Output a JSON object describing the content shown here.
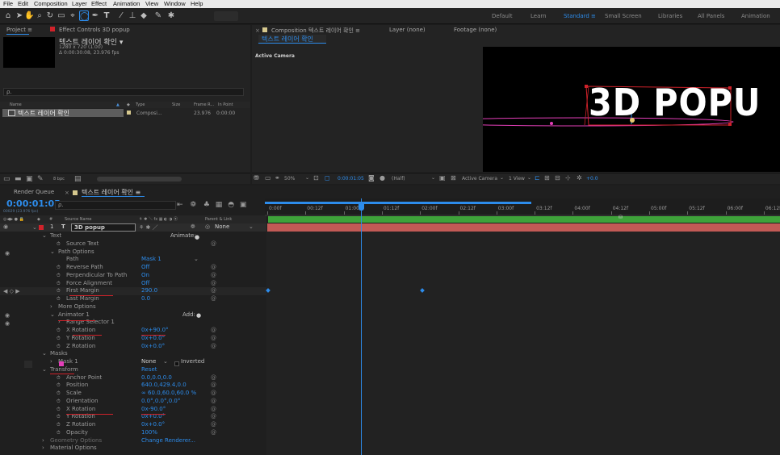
{
  "menu": [
    "File",
    "Edit",
    "Composition",
    "Layer",
    "Effect",
    "Animation",
    "View",
    "Window",
    "Help"
  ],
  "workspaces": [
    "Default",
    "Learn",
    "Standard",
    "Small Screen",
    "Libraries",
    "All Panels",
    "Animation"
  ],
  "project_panel": {
    "tab_project": "Project",
    "tab_effects": "Effect Controls 3D popup",
    "comp_name": "텍스트 레이어 확인 ▾",
    "comp_size": "1280 x 720 (1.00)",
    "comp_duration": "Δ 0:00:30:08, 23.976 fps",
    "search_placeholder": "ρ.",
    "col_name": "Name",
    "col_type": "Type",
    "col_size": "Size",
    "col_framerate": "Frame R...",
    "col_inpoint": "In Point",
    "item_name": "텍스트 레이어 확인",
    "item_type": "Composi...",
    "item_fps": "23.976",
    "item_in": "0:00:00",
    "bpc": "8 bpc"
  },
  "viewer": {
    "tab_comp": "Composition 텍스트 레이어 확인",
    "tab_layer": "Layer (none)",
    "tab_footage": "Footage (none)",
    "breadcrumb": "텍스트 레이어 확인",
    "active_camera": "Active Camera",
    "canvas_text": "3D POPU",
    "zoom": "50%",
    "timecode": "0:00:01:05",
    "resolution": "(Half)",
    "camera": "Active Camera",
    "views": "1 View",
    "exposure": "+0.0"
  },
  "timeline": {
    "tab_render": "Render Queue",
    "tab_comp": "텍스트 레이어 확인",
    "timecode": "0:00:01:05",
    "timecode_sub": "00029 (23.976 fps)",
    "search_placeholder": "ρ.",
    "col_source": "Source Name",
    "col_parent": "Parent & Link",
    "layer_num": "1",
    "layer_name": "3D popup",
    "parent_value": "None",
    "ruler": [
      "0:00f",
      "00:12f",
      "01:00f",
      "01:12f",
      "02:00f",
      "02:12f",
      "03:00f",
      "03:12f",
      "04:00f",
      "04:12f",
      "05:00f",
      "05:12f",
      "06:00f",
      "06:12f"
    ],
    "props": [
      {
        "label": "Text",
        "indent": 1,
        "arrow": "v",
        "sw": false,
        "value": "",
        "right": "Animate:"
      },
      {
        "label": "Source Text",
        "indent": 3,
        "arrow": "",
        "sw": true,
        "value": "",
        "right": ""
      },
      {
        "label": "Path Options",
        "indent": 2,
        "arrow": "v",
        "sw": false,
        "value": "",
        "right": ""
      },
      {
        "label": "Path",
        "indent": 3,
        "arrow": "",
        "sw": false,
        "value": "Mask 1",
        "right": ""
      },
      {
        "label": "Reverse Path",
        "indent": 3,
        "arrow": "",
        "sw": true,
        "value": "Off",
        "right": ""
      },
      {
        "label": "Perpendicular To Path",
        "indent": 3,
        "arrow": "",
        "sw": true,
        "value": "On",
        "right": ""
      },
      {
        "label": "Force Alignment",
        "indent": 3,
        "arrow": "",
        "sw": true,
        "value": "Off",
        "right": ""
      },
      {
        "label": "First Margin",
        "indent": 3,
        "arrow": "",
        "sw": true,
        "value": "290.0",
        "right": ""
      },
      {
        "label": "Last Margin",
        "indent": 3,
        "arrow": "",
        "sw": true,
        "value": "0.0",
        "right": ""
      },
      {
        "label": "More Options",
        "indent": 2,
        "arrow": ">",
        "sw": false,
        "value": "",
        "right": ""
      },
      {
        "label": "Animator 1",
        "indent": 2,
        "arrow": "v",
        "sw": false,
        "value": "",
        "right": "Add:"
      },
      {
        "label": "Range Selector 1",
        "indent": 3,
        "arrow": ">",
        "sw": false,
        "value": "",
        "right": ""
      },
      {
        "label": "X Rotation",
        "indent": 3,
        "arrow": "",
        "sw": true,
        "value": "0x+90.0°",
        "right": ""
      },
      {
        "label": "Y Rotation",
        "indent": 3,
        "arrow": "",
        "sw": true,
        "value": "0x+0.0°",
        "right": ""
      },
      {
        "label": "Z Rotation",
        "indent": 3,
        "arrow": "",
        "sw": true,
        "value": "0x+0.0°",
        "right": ""
      },
      {
        "label": "Masks",
        "indent": 1,
        "arrow": "v",
        "sw": false,
        "value": "",
        "right": ""
      },
      {
        "label": "Mask 1",
        "indent": 2,
        "arrow": ">",
        "sw": false,
        "value": "None",
        "right": "Inverted"
      },
      {
        "label": "Transform",
        "indent": 1,
        "arrow": "v",
        "sw": false,
        "value": "Reset",
        "right": ""
      },
      {
        "label": "Anchor Point",
        "indent": 3,
        "arrow": "",
        "sw": true,
        "value": "0.0,0.0,0.0",
        "right": ""
      },
      {
        "label": "Position",
        "indent": 3,
        "arrow": "",
        "sw": true,
        "value": "640.0,429.4,0.0",
        "right": ""
      },
      {
        "label": "Scale",
        "indent": 3,
        "arrow": "",
        "sw": true,
        "value": "∞ 60.0,60.0,60.0 %",
        "right": ""
      },
      {
        "label": "Orientation",
        "indent": 3,
        "arrow": "",
        "sw": true,
        "value": "0.0°,0.0°,0.0°",
        "right": ""
      },
      {
        "label": "X Rotation",
        "indent": 3,
        "arrow": "",
        "sw": true,
        "value": "0x-90.0°",
        "right": ""
      },
      {
        "label": "Y Rotation",
        "indent": 3,
        "arrow": "",
        "sw": true,
        "value": "0x+0.0°",
        "right": ""
      },
      {
        "label": "Z Rotation",
        "indent": 3,
        "arrow": "",
        "sw": true,
        "value": "0x+0.0°",
        "right": ""
      },
      {
        "label": "Opacity",
        "indent": 3,
        "arrow": "",
        "sw": true,
        "value": "100%",
        "right": ""
      },
      {
        "label": "Geometry Options",
        "indent": 1,
        "arrow": ">",
        "sw": false,
        "value": "Change Renderer...",
        "right": ""
      },
      {
        "label": "Material Options",
        "indent": 1,
        "arrow": ">",
        "sw": false,
        "value": "",
        "right": ""
      }
    ]
  },
  "colors": {
    "accent": "#2d8ceb",
    "label_red": "#d0222a",
    "layer_bar": "#c25a55",
    "mask_pink": "#e43fb9",
    "bg_dark": "#1d1d1d"
  }
}
